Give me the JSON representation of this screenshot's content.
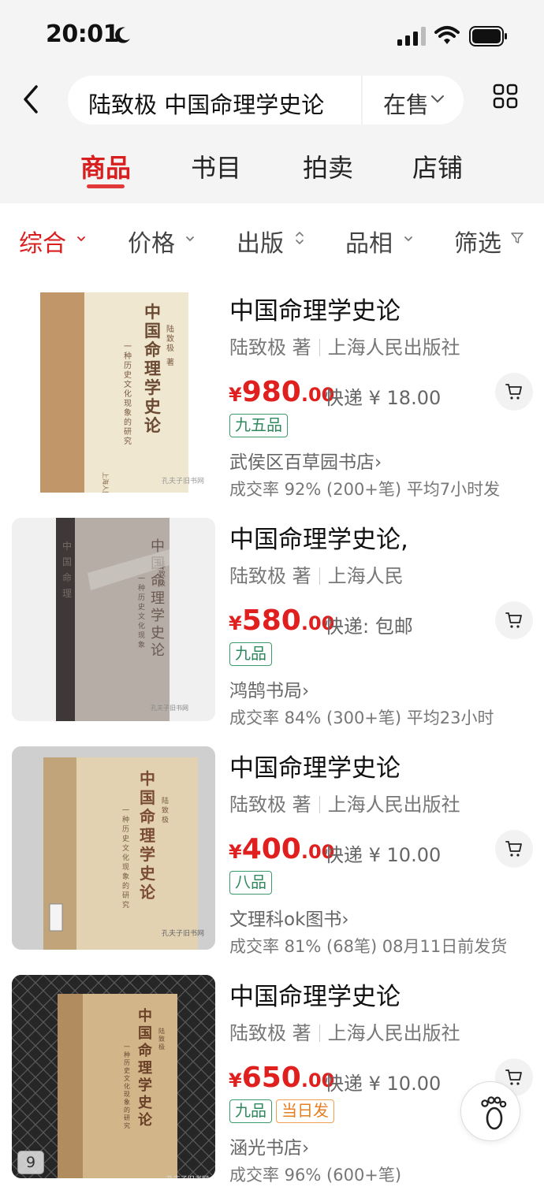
{
  "status_bar": {
    "time": "20:01"
  },
  "search": {
    "query": "陆致极 中国命理学史论",
    "status_filter": "在售"
  },
  "tabs": [
    {
      "label": "商品",
      "active": true
    },
    {
      "label": "书目",
      "active": false
    },
    {
      "label": "拍卖",
      "active": false
    },
    {
      "label": "店铺",
      "active": false
    }
  ],
  "filters": [
    {
      "label": "综合",
      "active": true
    },
    {
      "label": "价格",
      "active": false
    },
    {
      "label": "出版",
      "active": false
    },
    {
      "label": "品相",
      "active": false
    },
    {
      "label": "筛选",
      "active": false
    }
  ],
  "items": [
    {
      "title": "中国命理学史论",
      "author": "陆致极 著",
      "publisher": "上海人民出版社",
      "price_currency": "¥",
      "price_int": "980",
      "price_dec": ".00",
      "shipping": "快递 ¥ 18.00",
      "condition": "九五品",
      "shop": "武侯区百草园书店›",
      "stats": "成交率 92% (200+笔) 平均7小时发"
    },
    {
      "title": "中国命理学史论,",
      "author": "陆致极 著",
      "publisher": "上海人民",
      "price_currency": "¥",
      "price_int": "580",
      "price_dec": ".00",
      "shipping": "快递: 包邮",
      "condition": "九品",
      "shop": "鸿鹄书局›",
      "stats": "成交率 84% (300+笔) 平均23小时"
    },
    {
      "title": "中国命理学史论",
      "author": "陆致极 著",
      "publisher": "上海人民出版社",
      "price_currency": "¥",
      "price_int": "400",
      "price_dec": ".00",
      "shipping": "快递 ¥ 10.00",
      "condition": "八品",
      "shop": "文理科ok图书›",
      "stats": "成交率 81% (68笔) 08月11日前发货"
    },
    {
      "title": "中国命理学史论",
      "author": "陆致极 著",
      "publisher": "上海人民出版社",
      "price_currency": "¥",
      "price_int": "650",
      "price_dec": ".00",
      "shipping": "快递 ¥ 10.00",
      "condition": "九品",
      "badge_sameday": "当日发",
      "shop": "涵光书店›",
      "stats": "成交率 96% (600+笔)"
    }
  ],
  "cover": {
    "title_chars": "中国命理学史论",
    "subtitle": "一种历史文化现象的研究",
    "author_mark": "陆致极 著",
    "publisher_mark": "上海人民出版社",
    "watermark": "孔夫子旧书网"
  },
  "page_badge": "9",
  "colors": {
    "accent": "#d81e1e",
    "price": "#e0201f",
    "condition": "#2e8a5c",
    "sameday": "#e67e22"
  }
}
